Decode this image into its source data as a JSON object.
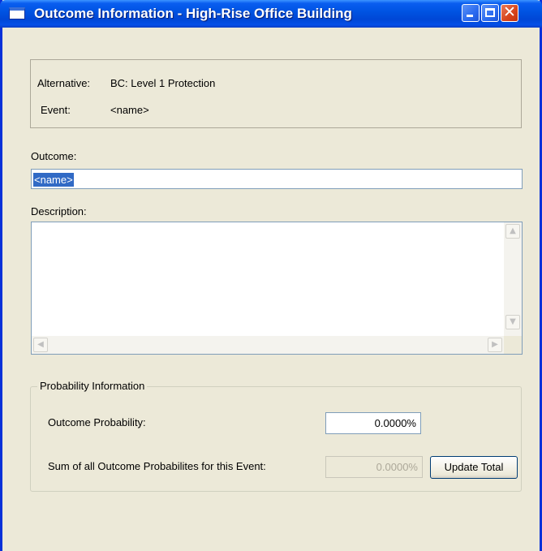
{
  "window": {
    "title": "Outcome Information - High-Rise Office Building"
  },
  "info": {
    "alternative_label": "Alternative:",
    "alternative_value": "BC: Level 1 Protection",
    "event_label": "Event:",
    "event_value": "<name>"
  },
  "outcome": {
    "label": "Outcome:",
    "value": "<name>"
  },
  "description": {
    "label": "Description:",
    "value": ""
  },
  "probability": {
    "group_title": "Probability Information",
    "outcome_label": "Outcome Probability:",
    "outcome_value": "0.0000%",
    "sum_label": "Sum of all Outcome Probabilites for this Event:",
    "sum_value": "0.0000%",
    "update_button": "Update Total"
  },
  "colors": {
    "title_bar": "#0054e3",
    "window_bg": "#ece9d8",
    "selection": "#316ac5"
  }
}
